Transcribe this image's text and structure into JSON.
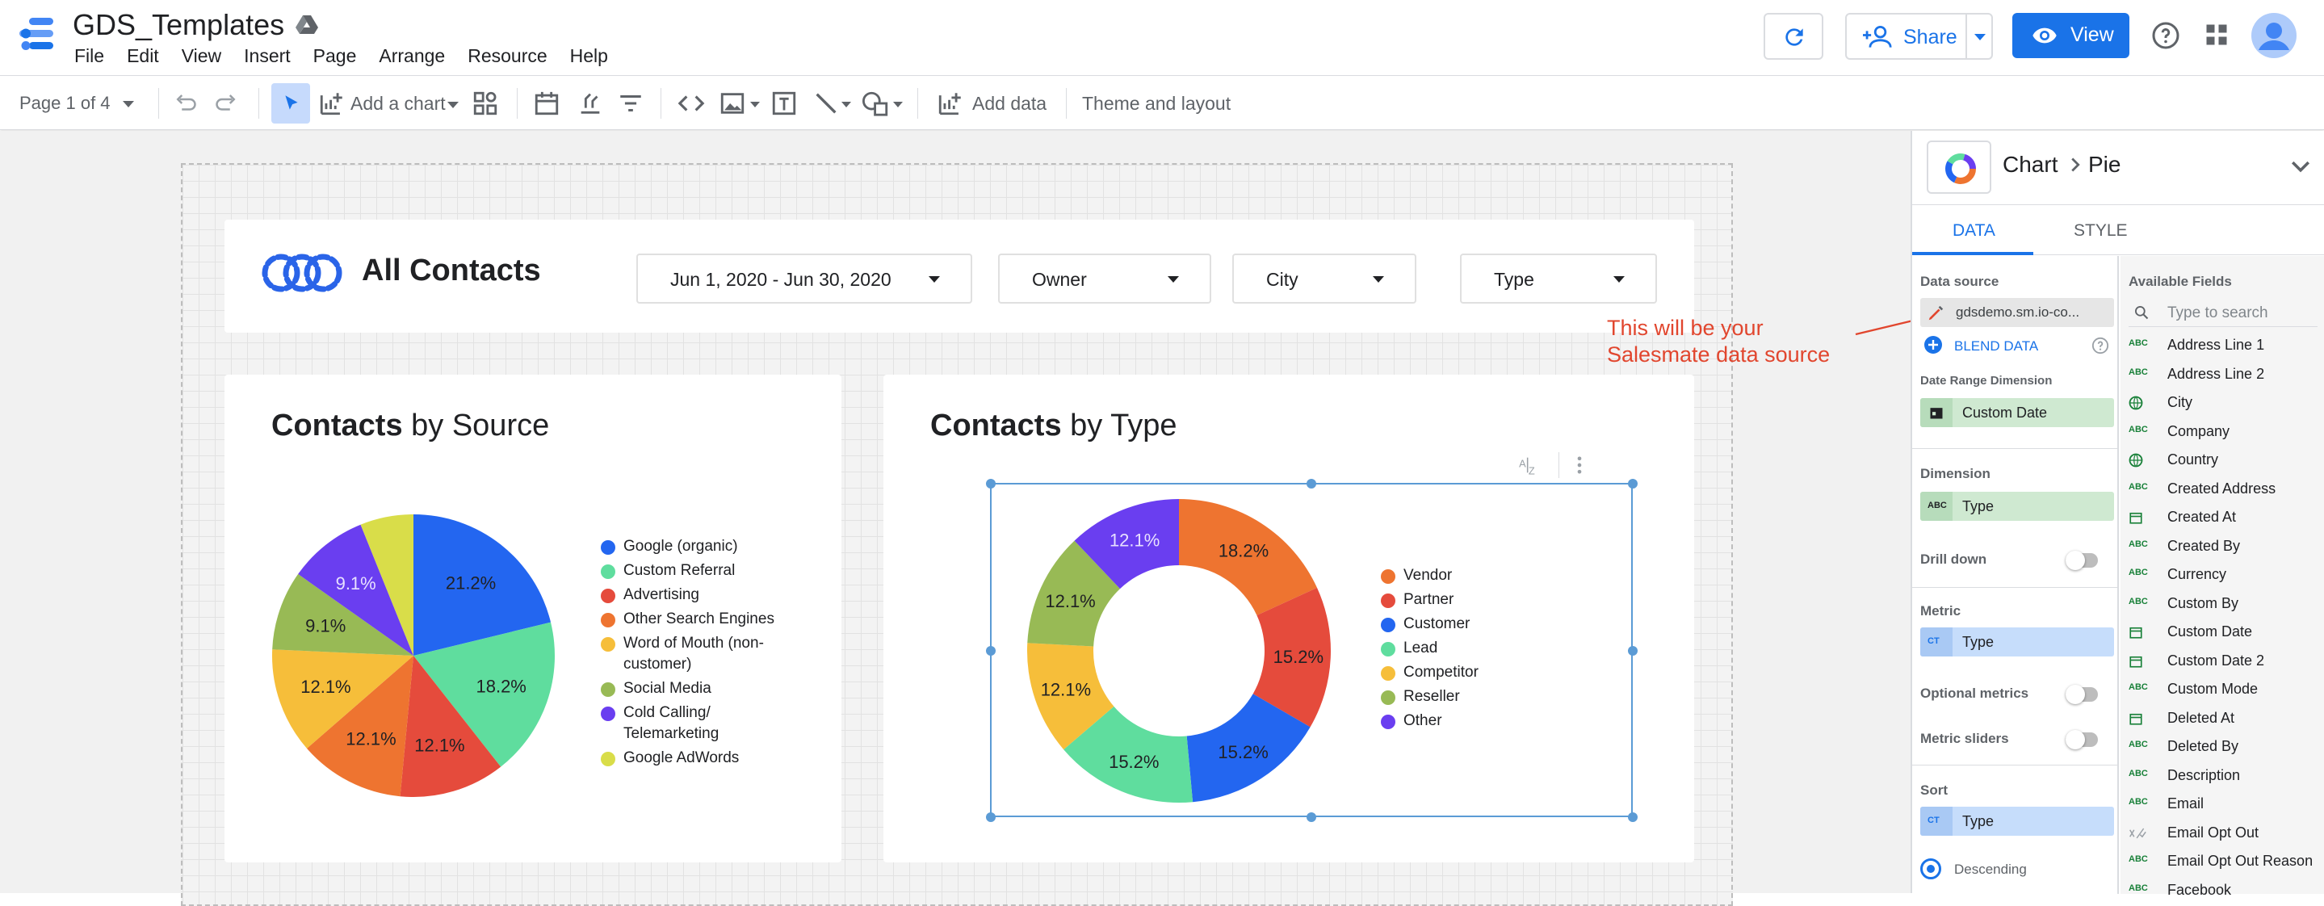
{
  "app": {
    "title": "GDS_Templates",
    "menu": [
      "File",
      "Edit",
      "View",
      "Insert",
      "Page",
      "Arrange",
      "Resource",
      "Help"
    ],
    "share_label": "Share",
    "view_label": "View"
  },
  "toolbar": {
    "page_indicator": "Page 1 of 4",
    "add_chart_label": "Add a chart",
    "add_data_label": "Add data",
    "theme_label": "Theme and layout"
  },
  "report": {
    "title": "All Contacts",
    "filters": {
      "date_range": "Jun 1, 2020 - Jun 30, 2020",
      "owner": "Owner",
      "city": "City",
      "type": "Type"
    }
  },
  "chart_data": [
    {
      "type": "pie",
      "title_bold": "Contacts",
      "title_rest": "by Source",
      "slices": [
        {
          "label": "Google (organic)",
          "value": 21.2,
          "color": "#2366f0"
        },
        {
          "label": "Custom Referral",
          "value": 18.2,
          "color": "#5fdd9e"
        },
        {
          "label": "Advertising",
          "value": 12.1,
          "color": "#e54b3c"
        },
        {
          "label": "Other Search Engines",
          "value": 12.1,
          "color": "#ee7430"
        },
        {
          "label": "Word of Mouth (non-customer)",
          "value": 12.1,
          "color": "#f6be3a"
        },
        {
          "label": "Social Media",
          "value": 9.1,
          "color": "#98ba55"
        },
        {
          "label": "Cold Calling/ Telemarketing",
          "value": 9.1,
          "color": "#6a3ef0"
        },
        {
          "label": "Google AdWords",
          "value": 6.1,
          "color": "#d9dd49"
        }
      ],
      "slice_labels": [
        "21.2%",
        "18.2%",
        "12.1%",
        "12.1%",
        "12.1%",
        "9.1%",
        "9.1%",
        ""
      ],
      "legend": [
        "Google (organic)",
        "Custom Referral",
        "Advertising",
        "Other Search Engines",
        "Word of Mouth (non-",
        "customer)",
        "Social Media",
        "Cold Calling/",
        "Telemarketing",
        "Google AdWords"
      ]
    },
    {
      "type": "pie",
      "donut": true,
      "title_bold": "Contacts",
      "title_rest": "by Type",
      "slices": [
        {
          "label": "Vendor",
          "value": 18.2,
          "color": "#ee7430"
        },
        {
          "label": "Partner",
          "value": 15.2,
          "color": "#e54b3c"
        },
        {
          "label": "Customer",
          "value": 15.2,
          "color": "#2366f0"
        },
        {
          "label": "Lead",
          "value": 15.2,
          "color": "#5fdd9e"
        },
        {
          "label": "Competitor",
          "value": 12.1,
          "color": "#f6be3a"
        },
        {
          "label": "Reseller",
          "value": 12.1,
          "color": "#98ba55"
        },
        {
          "label": "Other",
          "value": 12.1,
          "color": "#6a3ef0"
        }
      ],
      "slice_labels": [
        "18.2%",
        "15.2%",
        "15.2%",
        "15.2%",
        "12.1%",
        "12.1%",
        "12.1%"
      ]
    }
  ],
  "annotation": {
    "line1": "This will be your",
    "line2": "Salesmate data source"
  },
  "panel": {
    "crumb_chart": "Chart",
    "crumb_pie": "Pie",
    "tab_data": "DATA",
    "tab_style": "STYLE",
    "data_source_label": "Data source",
    "data_source_value": "gdsdemo.sm.io-co...",
    "blend_label": "BLEND DATA",
    "date_range_label": "Date Range Dimension",
    "date_range_value": "Custom Date",
    "dimension_label": "Dimension",
    "dimension_value": "Type",
    "drill_down_label": "Drill down",
    "metric_label": "Metric",
    "metric_value": "Type",
    "optional_metrics_label": "Optional metrics",
    "metric_sliders_label": "Metric sliders",
    "sort_label": "Sort",
    "sort_value": "Type",
    "descending_label": "Descending",
    "type_tag_abc": "ABC",
    "type_tag_ct": "CT",
    "available_label": "Available Fields",
    "search_placeholder": "Type to search",
    "fields": [
      {
        "name": "Address Line 1",
        "kind": "ABC"
      },
      {
        "name": "Address Line 2",
        "kind": "ABC"
      },
      {
        "name": "City",
        "kind": "geo"
      },
      {
        "name": "Company",
        "kind": "ABC"
      },
      {
        "name": "Country",
        "kind": "geo"
      },
      {
        "name": "Created Address",
        "kind": "ABC"
      },
      {
        "name": "Created At",
        "kind": "date"
      },
      {
        "name": "Created By",
        "kind": "ABC"
      },
      {
        "name": "Currency",
        "kind": "ABC"
      },
      {
        "name": "Custom By",
        "kind": "ABC"
      },
      {
        "name": "Custom Date",
        "kind": "date"
      },
      {
        "name": "Custom Date 2",
        "kind": "date"
      },
      {
        "name": "Custom Mode",
        "kind": "ABC"
      },
      {
        "name": "Deleted At",
        "kind": "date"
      },
      {
        "name": "Deleted By",
        "kind": "ABC"
      },
      {
        "name": "Description",
        "kind": "ABC"
      },
      {
        "name": "Email",
        "kind": "ABC"
      },
      {
        "name": "Email Opt Out",
        "kind": "bool"
      },
      {
        "name": "Email Opt Out Reason",
        "kind": "ABC"
      },
      {
        "name": "Facebook",
        "kind": "ABC"
      }
    ]
  }
}
